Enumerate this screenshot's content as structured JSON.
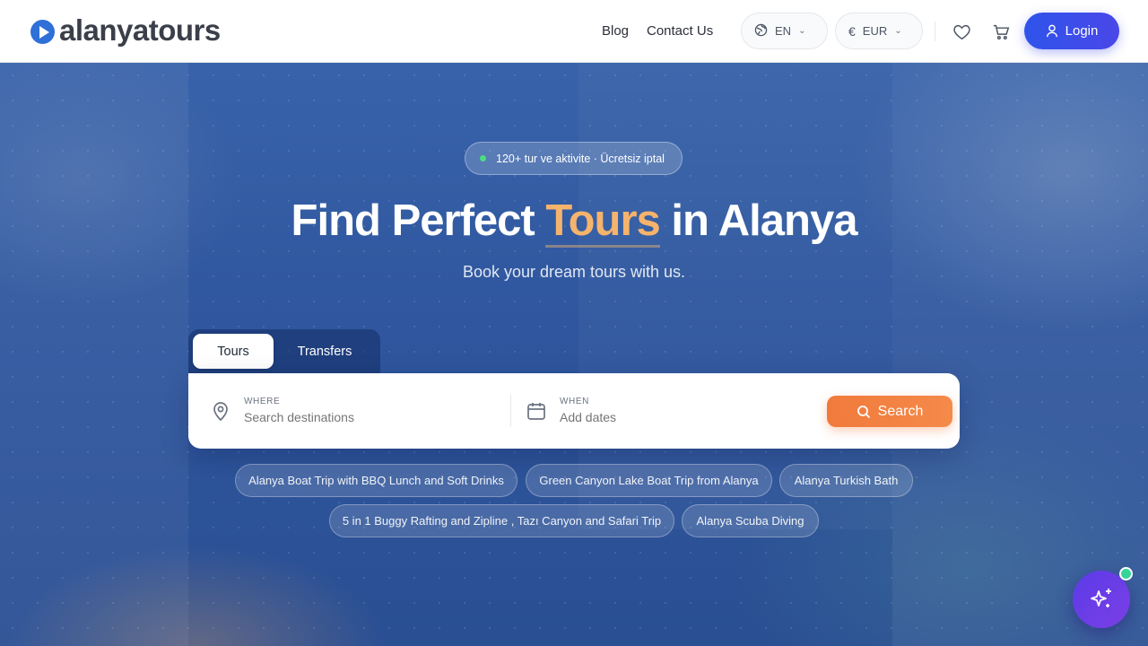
{
  "brand": {
    "name": "alanyatours"
  },
  "nav": {
    "links": [
      "Blog",
      "Contact Us"
    ],
    "language": "EN",
    "currency_symbol": "€",
    "currency": "EUR",
    "login_label": "Login"
  },
  "hero": {
    "badge": "120+ tur ve aktivite · Ücretsiz iptal",
    "title_before": "Find Perfect ",
    "title_highlight": "Tours",
    "title_after": " in Alanya",
    "subtitle": "Book your dream tours with us."
  },
  "search": {
    "tabs": [
      "Tours",
      "Transfers"
    ],
    "active_tab": "Tours",
    "where_label": "WHERE",
    "where_placeholder": "Search destinations",
    "when_label": "WHEN",
    "when_placeholder": "Add dates",
    "button_label": "Search"
  },
  "suggestions": [
    "Alanya Boat Trip with BBQ Lunch and Soft Drinks",
    "Green Canyon Lake Boat Trip from Alanya",
    "Alanya Turkish Bath",
    "5 in 1 Buggy Rafting and Zipline , Tazı Canyon and Safari Trip",
    "Alanya Scuba Diving"
  ],
  "icons": {
    "language": "globe-icon",
    "wishlist": "heart-icon",
    "cart": "cart-icon",
    "login": "user-icon",
    "where": "map-pin-icon",
    "when": "calendar-icon",
    "search": "search-icon",
    "assistant": "sparkles-icon"
  },
  "colors": {
    "primary": "#2f54eb",
    "accent": "#f07a3c",
    "highlight": "#f5b36c",
    "assistant": "#6a3de6",
    "status_online": "#34d399"
  }
}
